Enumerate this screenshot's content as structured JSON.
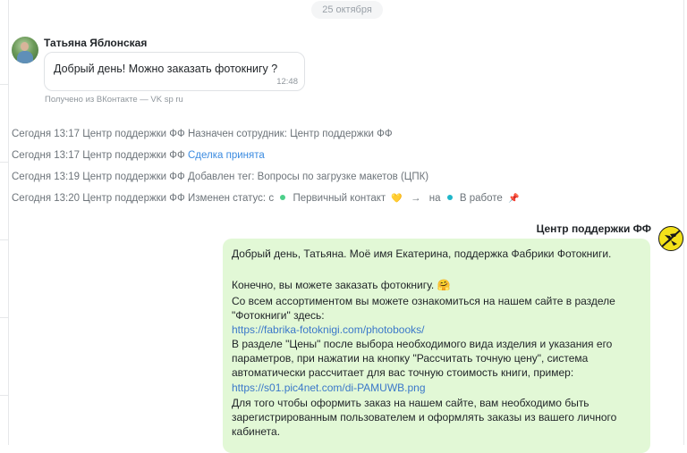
{
  "date_divider": "25 октября",
  "incoming": {
    "sender": "Татьяна Яблонская",
    "text": "Добрый день! Можно заказать фотокнигу ?",
    "time": "12:48",
    "source": "Получено из ВКонтакте — VK sp ru"
  },
  "log": [
    {
      "time": "Сегодня 13:17",
      "actor": "Центр поддержки ФФ",
      "text": "Назначен сотрудник: Центр поддержки ФФ"
    },
    {
      "time": "Сегодня 13:17",
      "actor": "Центр поддержки ФФ",
      "link": "Сделка принята"
    },
    {
      "time": "Сегодня 13:19",
      "actor": "Центр поддержки ФФ",
      "text": "Добавлен тег: Вопросы по загрузке макетов (ЦПК)"
    },
    {
      "time": "Сегодня 13:20",
      "actor": "Центр поддержки ФФ",
      "prefix": "Изменен статус: с",
      "from_status": "Первичный контакт",
      "from_icon": "💛",
      "from_color": "#4ccf8a",
      "to_word": "на",
      "to_status": "В работе",
      "to_icon": "📌",
      "to_color": "#1fb6c9"
    }
  ],
  "outgoing": {
    "sender": "Центр поддержки ФФ",
    "lines": [
      "Добрый день, Татьяна. Моё имя Екатерина, поддержка Фабрики Фотокниги.",
      "Конечно, вы можете заказать фотокнигу. 🤗",
      "Со всем ассортиментом вы можете ознакомиться на нашем сайте в разделе",
      "\"Фотокниги\" здесь:",
      "https://fabrika-fotoknigi.com/photobooks/",
      "В разделе \"Цены\" после выбора необходимого вида изделия и указания его",
      "параметров, при нажатии на кнопку \"Рассчитать точную цену\", система",
      "автоматически рассчитает для вас точную стоимость книги, пример:",
      "https://s01.pic4net.com/di-PAMUWB.png",
      "Для того чтобы оформить заказ на нашем сайте, вам необходимо быть",
      "зарегистрированным пользователем и оформлять заказы из вашего личного",
      "кабинета."
    ]
  },
  "colors": {
    "outgoing_bubble": "#e2f8d6",
    "link": "#3b78c9",
    "muted": "#6d747a"
  }
}
